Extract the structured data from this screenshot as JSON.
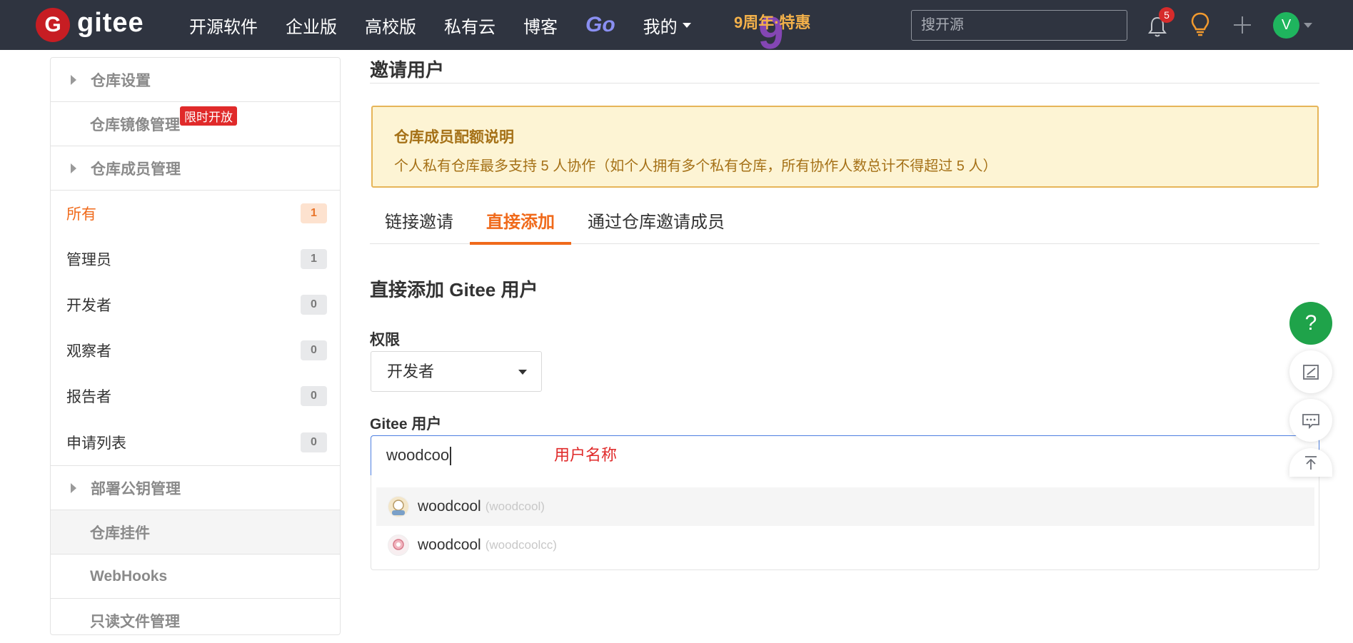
{
  "nav": {
    "logo_letter": "G",
    "logo_text": "gitee",
    "links": [
      "开源软件",
      "企业版",
      "高校版",
      "私有云",
      "博客"
    ],
    "go_label": "Go",
    "mine_label": "我的",
    "promo_text": "9周年·特惠",
    "search_placeholder": "搜开源",
    "notification_count": "5",
    "avatar_letter": "V",
    "icons": [
      "bell-icon",
      "lightbulb-icon",
      "plus-icon",
      "avatar"
    ]
  },
  "sidebar": {
    "repo_settings": "仓库设置",
    "mirror_mgmt": "仓库镜像管理",
    "limited_badge": "限时开放",
    "member_mgmt": "仓库成员管理",
    "members": [
      {
        "label": "所有",
        "count": "1",
        "active": true
      },
      {
        "label": "管理员",
        "count": "1"
      },
      {
        "label": "开发者",
        "count": "0"
      },
      {
        "label": "观察者",
        "count": "0"
      },
      {
        "label": "报告者",
        "count": "0"
      },
      {
        "label": "申请列表",
        "count": "0"
      }
    ],
    "deploy_keys": "部署公钥管理",
    "repo_hooks": "仓库挂件",
    "webhooks": "WebHooks",
    "readonly_files": "只读文件管理"
  },
  "main": {
    "title": "邀请用户",
    "notice": {
      "title": "仓库成员配额说明",
      "text": "个人私有仓库最多支持 5 人协作（如个人拥有多个私有仓库，所有协作人数总计不得超过 5 人）"
    },
    "tabs": [
      "链接邀请",
      "直接添加",
      "通过仓库邀请成员"
    ],
    "active_tab": "直接添加",
    "section_title": "直接添加 Gitee 用户",
    "permission_label": "权限",
    "permission_value": "开发者",
    "user_label": "Gitee 用户",
    "user_input_value": "woodcoo",
    "annotation": "用户名称",
    "suggestions": [
      {
        "name": "woodcool",
        "login": "(woodcool)"
      },
      {
        "name": "woodcool",
        "login": "(woodcoolcc)"
      }
    ]
  },
  "floating": {
    "help_label": "?",
    "icons": [
      "help-icon",
      "edit-icon",
      "message-icon",
      "back-to-top-icon"
    ]
  },
  "colors": {
    "nav_bg": "#2f3440",
    "accent_orange": "#f06a1b",
    "brand_red": "#c71d23",
    "help_green": "#1fa34a",
    "notice_bg": "#fdf4d4",
    "notice_text": "#a57117"
  }
}
